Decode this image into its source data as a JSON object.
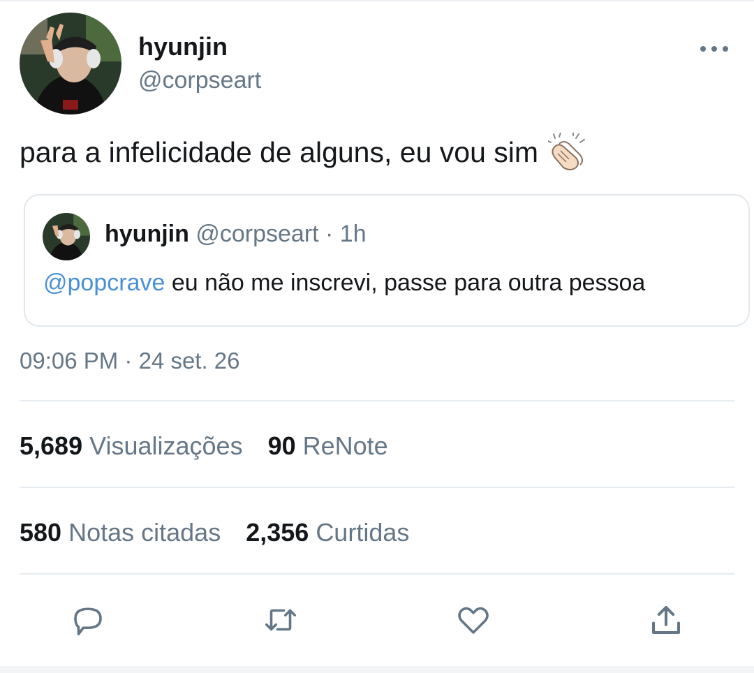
{
  "author": {
    "name": "hyunjin",
    "handle": "@corpseart"
  },
  "tweet": {
    "text": "para a infelicidade de alguns, eu vou sim",
    "emoji_icon": "clapping-hands-icon"
  },
  "quoted": {
    "name": "hyunjin",
    "meta": "@corpseart · 1h",
    "mention": "@popcrave",
    "text": " eu não me inscrevi, passe para outra pessoa"
  },
  "timestamp": "09:06 PM · 24 set. 26",
  "stats_row1": [
    {
      "count": "5,689",
      "label": "Visualizações"
    },
    {
      "count": "90",
      "label": "ReNote"
    }
  ],
  "stats_row2": [
    {
      "count": "580",
      "label": "Notas citadas"
    },
    {
      "count": "2,356",
      "label": "Curtidas"
    }
  ],
  "colors": {
    "text": "#14171a",
    "muted": "#657786",
    "link": "#4a90d9",
    "divider": "#e6ecf0"
  }
}
